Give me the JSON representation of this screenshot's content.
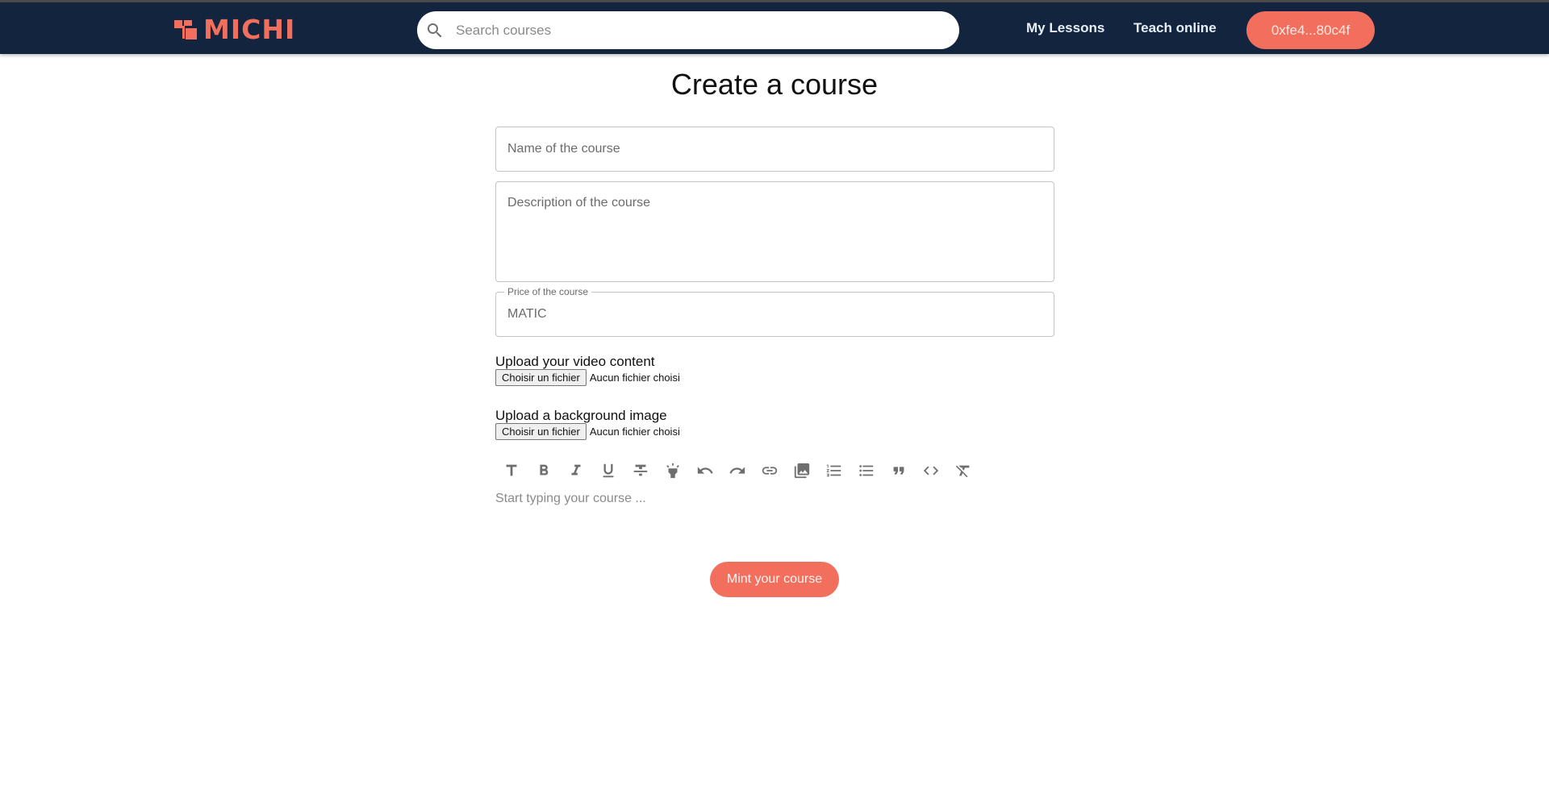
{
  "navbar": {
    "logo_text": "MICHI",
    "search_placeholder": "Search courses",
    "links": [
      {
        "label": "My Lessons"
      },
      {
        "label": "Teach online"
      }
    ],
    "wallet_address": "0xfe4...80c4f"
  },
  "page": {
    "title": "Create a course"
  },
  "form": {
    "name_placeholder": "Name of the course",
    "description_placeholder": "Description of the course",
    "price_label": "Price of the course",
    "price_placeholder": "MATIC",
    "video_upload": {
      "label": "Upload your video content",
      "button": "Choisir un fichier",
      "status": "Aucun fichier choisi"
    },
    "image_upload": {
      "label": "Upload a background image",
      "button": "Choisir un fichier",
      "status": "Aucun fichier choisi"
    },
    "editor_toolbar": [
      "text-size",
      "bold",
      "italic",
      "underline",
      "strikethrough",
      "highlight",
      "undo",
      "redo",
      "link",
      "image",
      "ordered-list",
      "bulleted-list",
      "quote",
      "code",
      "clear-format"
    ],
    "editor_placeholder": "Start typing your course ...",
    "submit_label": "Mint your course"
  },
  "colors": {
    "navbar": "#13243f",
    "accent": "#f26f5e"
  }
}
